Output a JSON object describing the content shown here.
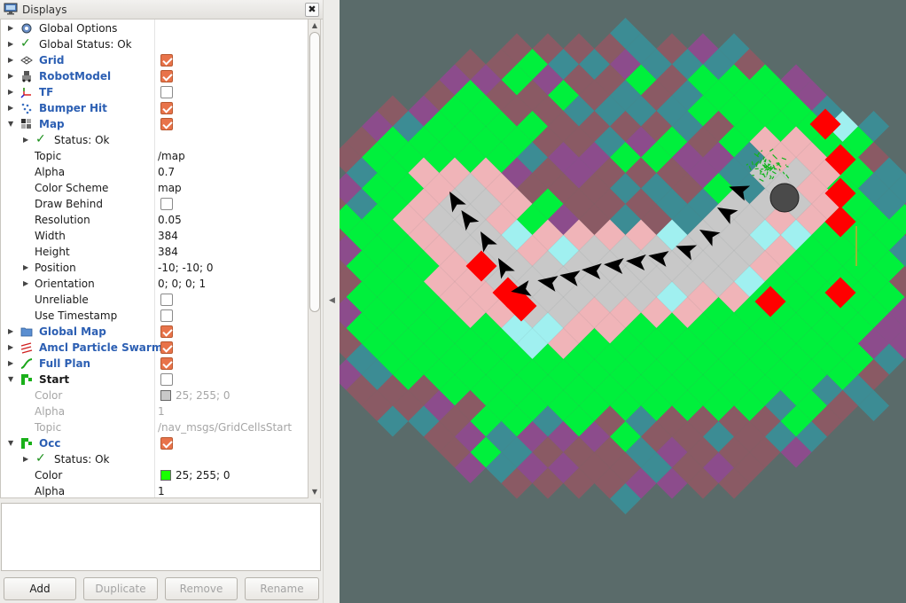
{
  "panel": {
    "title": "Displays",
    "close": "✖"
  },
  "tree": [
    {
      "label": "Global Options",
      "arrow": "▶",
      "icon": "gear-icon"
    },
    {
      "label": "Global Status: Ok",
      "arrow": "▶",
      "icon": "check-icon"
    },
    {
      "label": "Grid",
      "arrow": "▶",
      "icon": "grid-icon",
      "checked": true
    },
    {
      "label": "RobotModel",
      "arrow": "▶",
      "icon": "robot-icon",
      "checked": true
    },
    {
      "label": "TF",
      "arrow": "▶",
      "icon": "axes-icon",
      "checked": false
    },
    {
      "label": "Bumper Hit",
      "arrow": "▶",
      "icon": "points-icon",
      "checked": true
    },
    {
      "label": "Map",
      "arrow": "▼",
      "icon": "map-icon",
      "checked": true
    },
    {
      "label": "Status: Ok",
      "arrow": "▶"
    },
    {
      "label": "Topic",
      "value": "/map"
    },
    {
      "label": "Alpha",
      "value": "0.7"
    },
    {
      "label": "Color Scheme",
      "value": "map"
    },
    {
      "label": "Draw Behind",
      "checked": false
    },
    {
      "label": "Resolution",
      "value": "0.05"
    },
    {
      "label": "Width",
      "value": "384"
    },
    {
      "label": "Height",
      "value": "384"
    },
    {
      "label": "Position",
      "arrow": "▶",
      "value": "-10; -10; 0"
    },
    {
      "label": "Orientation",
      "arrow": "▶",
      "value": "0; 0; 0; 1"
    },
    {
      "label": "Unreliable",
      "checked": false
    },
    {
      "label": "Use Timestamp",
      "checked": false
    },
    {
      "label": "Global Map",
      "arrow": "▶",
      "icon": "folder-icon",
      "checked": true
    },
    {
      "label": "Amcl Particle Swarm",
      "arrow": "▶",
      "icon": "pose-array-icon",
      "checked": true
    },
    {
      "label": "Full Plan",
      "arrow": "▶",
      "icon": "path-icon",
      "checked": true
    },
    {
      "label": "Start",
      "arrow": "▼",
      "icon": "grid-cells-icon",
      "checked": false
    },
    {
      "label": "Color",
      "value": "25; 255; 0",
      "swatch": "#c8c8c8"
    },
    {
      "label": "Alpha",
      "value": "1"
    },
    {
      "label": "Topic",
      "value": "/nav_msgs/GridCellsStart"
    },
    {
      "label": "Occ",
      "arrow": "▼",
      "icon": "grid-cells-icon",
      "checked": true
    },
    {
      "label": "Status: Ok",
      "arrow": "▶"
    },
    {
      "label": "Color",
      "value": "25; 255; 0",
      "swatch": "#19ff00"
    },
    {
      "label": "Alpha",
      "value": "1"
    }
  ],
  "buttons": {
    "add": "Add",
    "duplicate": "Duplicate",
    "remove": "Remove",
    "rename": "Rename"
  },
  "colors": {
    "background": "#5a6b6a",
    "free": "#00f03c",
    "inflation": "#f0b4b8",
    "unknown_near": "#c8c8c8",
    "lethal": "#ff0000",
    "cyan": "#a0f0f0",
    "teal": "#3c8c94",
    "purple": "#8c4c8c",
    "brown": "#8a5a64",
    "plan": "#000000"
  }
}
